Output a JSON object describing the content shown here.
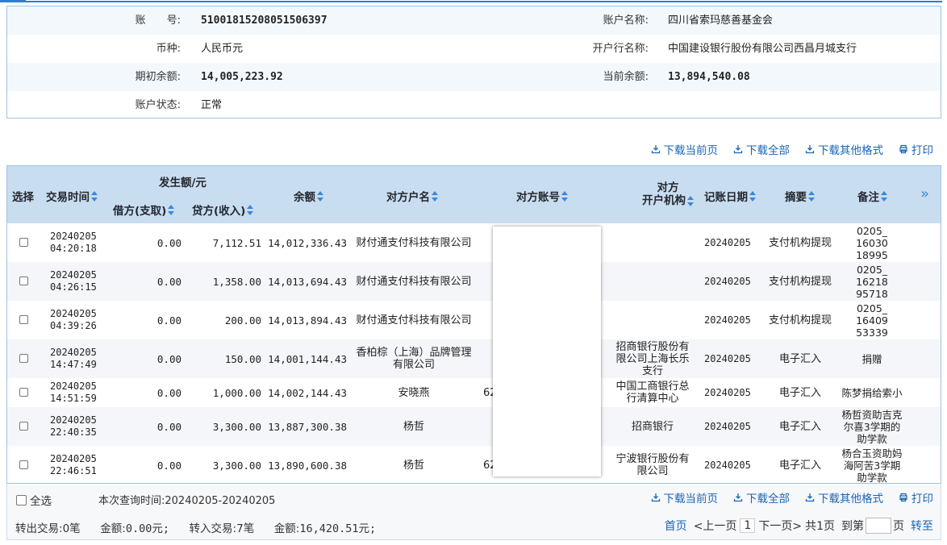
{
  "account": {
    "labels": {
      "account_no": "账　　号:",
      "currency": "币种:",
      "opening_balance": "期初余额:",
      "status": "账户状态:",
      "account_name": "账户名称:",
      "bank_name": "开户行名称:",
      "current_balance": "当前余额:"
    },
    "account_no": "51001815208051506397",
    "currency": "人民币元",
    "opening_balance": "14,005,223.92",
    "status": "正常",
    "account_name": "四川省索玛慈善基金会",
    "bank_name": "中国建设银行股份有限公司西昌月城支行",
    "current_balance": "13,894,540.08"
  },
  "toolbar": {
    "download_page": "下载当前页",
    "download_all": "下载全部",
    "download_other": "下载其他格式",
    "print": "打印"
  },
  "table": {
    "headers": {
      "select": "选择",
      "time": "交易时间",
      "amount_group": "发生额/元",
      "debit": "借方(支取)",
      "credit": "贷方(收入)",
      "balance": "余额",
      "party_name": "对方户名",
      "party_account": "对方账号",
      "party_bank_line1": "对方",
      "party_bank_line2": "开户机构",
      "post_date": "记账日期",
      "summary": "摘要",
      "remark": "备注",
      "more": "»"
    },
    "rows": [
      {
        "date": "20240205",
        "time": "04:20:18",
        "debit": "0.00",
        "credit": "7,112.51",
        "balance": "14,012,336.43",
        "party": "财付通支付科技有限公司",
        "acct": "",
        "bank": "",
        "post": "20240205",
        "summary": "支付机构提现",
        "remark": "0205_ 16030 18995"
      },
      {
        "date": "20240205",
        "time": "04:26:15",
        "debit": "0.00",
        "credit": "1,358.00",
        "balance": "14,013,694.43",
        "party": "财付通支付科技有限公司",
        "acct": "",
        "bank": "",
        "post": "20240205",
        "summary": "支付机构提现",
        "remark": "0205_ 16218 95718"
      },
      {
        "date": "20240205",
        "time": "04:39:26",
        "debit": "0.00",
        "credit": "200.00",
        "balance": "14,013,894.43",
        "party": "财付通支付科技有限公司",
        "acct": "",
        "bank": "",
        "post": "20240205",
        "summary": "支付机构提现",
        "remark": "0205_ 16409 53339"
      },
      {
        "date": "20240205",
        "time": "14:47:49",
        "debit": "0.00",
        "credit": "150.00",
        "balance": "14,001,144.43",
        "party": "香柏棕（上海）品牌管理有限公司",
        "acct": "",
        "bank": "招商银行股份有限公司上海长乐支行",
        "post": "20240205",
        "summary": "电子汇入",
        "remark": "捐赠"
      },
      {
        "date": "20240205",
        "time": "14:51:59",
        "debit": "0.00",
        "credit": "1,000.00",
        "balance": "14,002,144.43",
        "party": "安晓燕",
        "acct": "62",
        "bank": "中国工商银行总行清算中心",
        "post": "20240205",
        "summary": "电子汇入",
        "remark": "陈梦捐给索小"
      },
      {
        "date": "20240205",
        "time": "22:40:35",
        "debit": "0.00",
        "credit": "3,300.00",
        "balance": "13,887,300.38",
        "party": "杨哲",
        "acct": "",
        "bank": "招商银行",
        "post": "20240205",
        "summary": "电子汇入",
        "remark": "杨哲资助吉克尔喜3学期的助学款"
      },
      {
        "date": "20240205",
        "time": "22:46:51",
        "debit": "0.00",
        "credit": "3,300.00",
        "balance": "13,890,600.38",
        "party": "杨哲",
        "acct": "62",
        "bank": "宁波银行股份有限公司",
        "post": "20240205",
        "summary": "电子汇入",
        "remark": "杨合玉资助妈海阿苦3学期助学款"
      }
    ]
  },
  "footer": {
    "select_all": "全选",
    "query_time_label": "本次查询时间:",
    "query_time": "20240205-20240205",
    "out_tx_label": "转出交易:",
    "out_tx": "0笔",
    "out_amount_label": "金额:",
    "out_amount": "0.00元;",
    "in_tx_label": "转入交易:",
    "in_tx": "7笔",
    "in_amount_label": "金额:",
    "in_amount": "16,420.51元;"
  },
  "pager": {
    "first": "首页",
    "prev": "<上一页",
    "current": "1",
    "next": "下一页>",
    "total": "共1页",
    "goto_label": "到第",
    "goto_unit": "页",
    "go": "转至"
  },
  "colors": {
    "accent": "#2c7fd0",
    "link": "#1a66b5",
    "header_bg": "#c9ddf1"
  }
}
